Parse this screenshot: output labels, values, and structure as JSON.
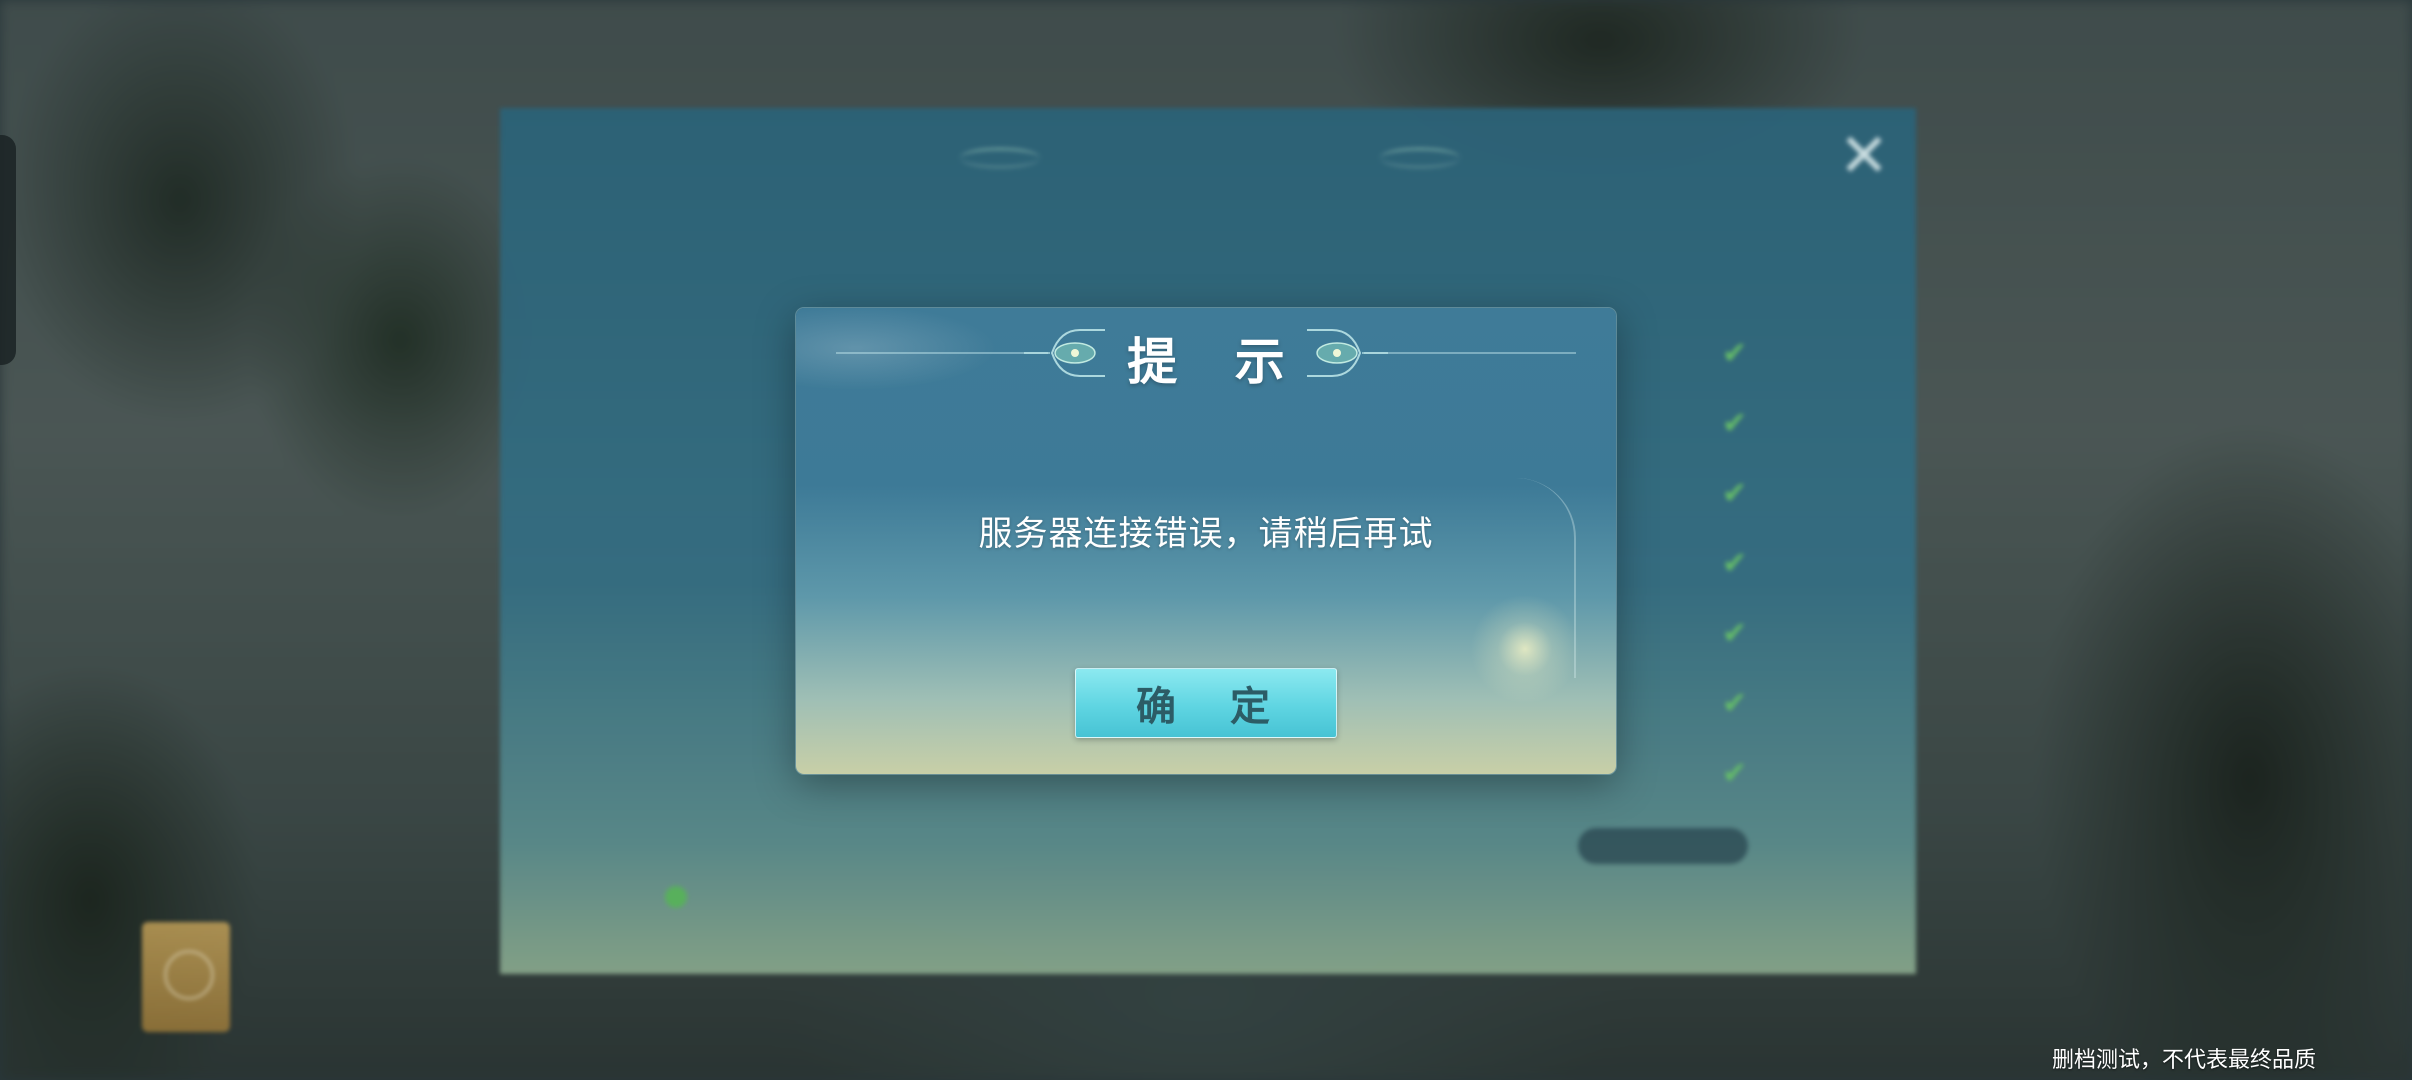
{
  "background_panel": {
    "title": "",
    "close_icon": "close-icon",
    "column_left": "",
    "column_right": "",
    "rows": [
      {
        "label": "",
        "value": ""
      },
      {
        "label": "",
        "value": ""
      },
      {
        "label": "",
        "value": ""
      },
      {
        "label": "",
        "value": ""
      },
      {
        "label": "",
        "value": ""
      },
      {
        "label": "",
        "value": ""
      },
      {
        "label": "",
        "value": ""
      }
    ],
    "result_label": "",
    "result_button": "",
    "tip": ""
  },
  "dialog": {
    "title": "提 示",
    "message": "服务器连接错误，请稍后再试",
    "ok_label": "确 定"
  },
  "watermark": "删档测试，不代表最终品质",
  "colors": {
    "dialog_top": "#3f7b98",
    "dialog_bottom": "#c8cfa7",
    "button": "#5fd5e2",
    "check": "#67c26a"
  }
}
